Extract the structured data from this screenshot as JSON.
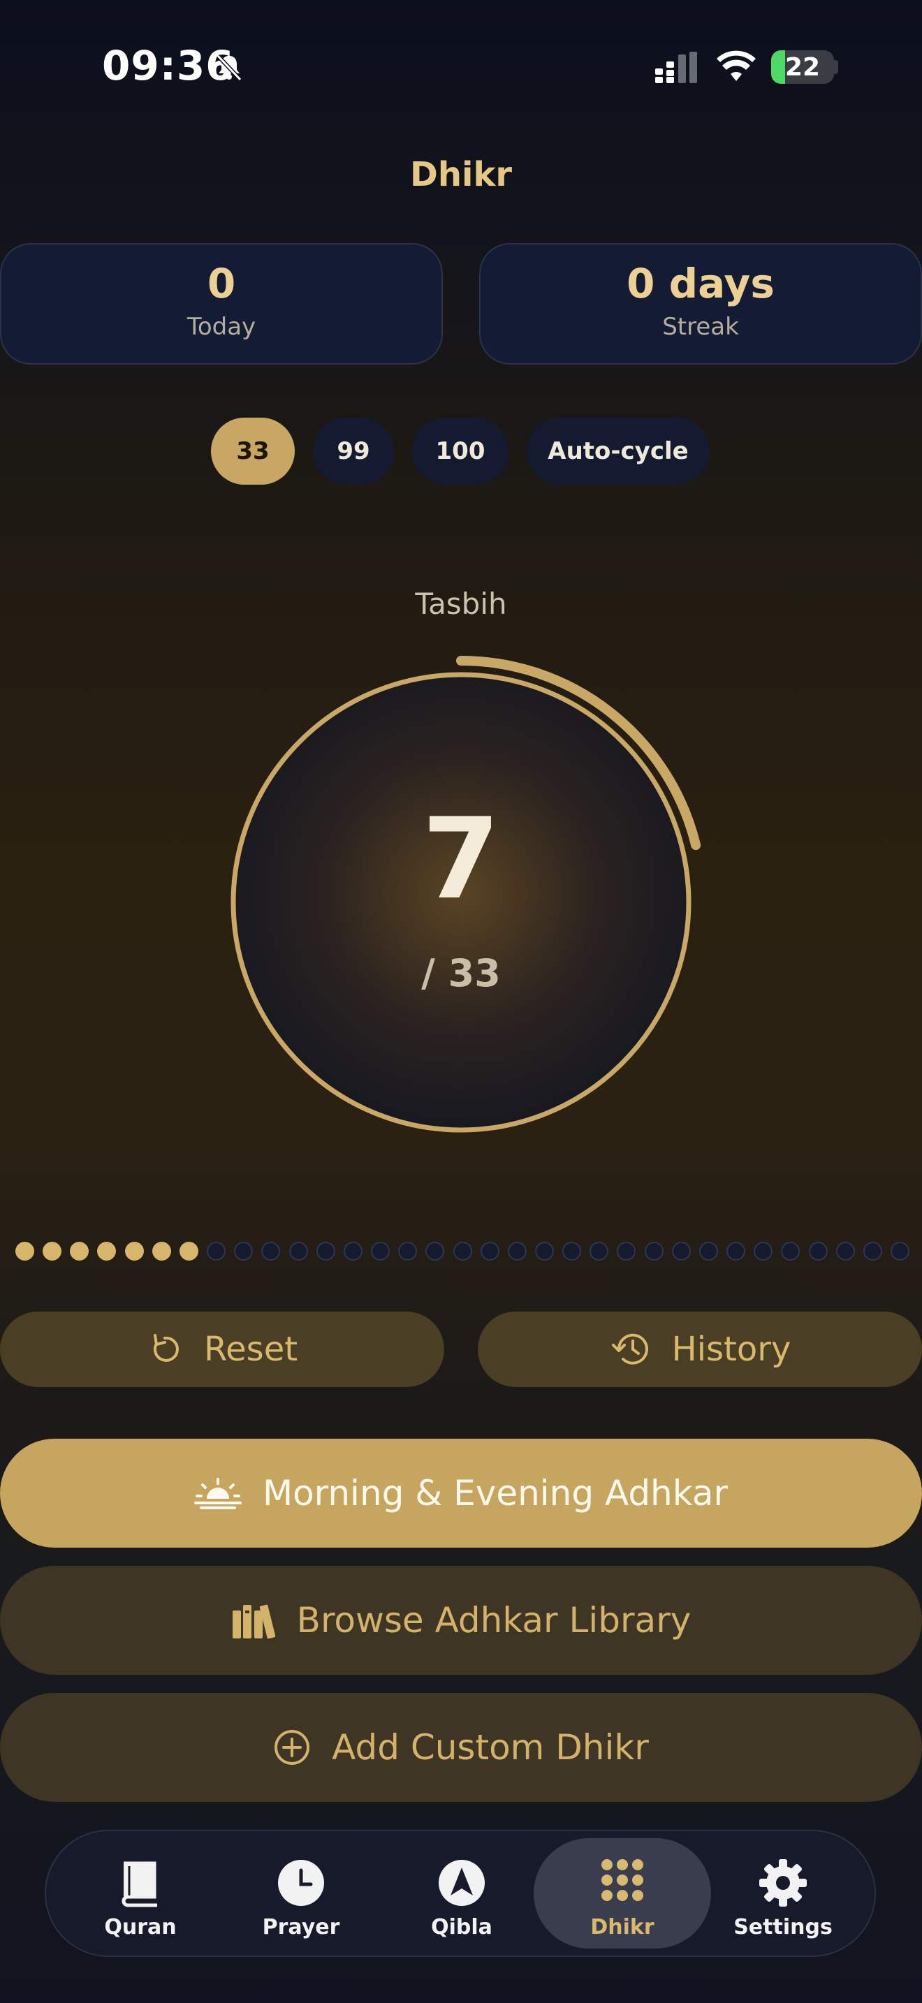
{
  "status_bar": {
    "time": "09:36",
    "battery": "22"
  },
  "header": {
    "title": "Dhikr"
  },
  "stats": {
    "today": {
      "value": "0",
      "label": "Today"
    },
    "streak": {
      "value": "0 days",
      "label": "Streak"
    }
  },
  "targets": [
    "33",
    "99",
    "100",
    "Auto-cycle"
  ],
  "selected_target": "33",
  "counter": {
    "mode": "Tasbih",
    "count": "7",
    "goal": "/ 33",
    "progress_fraction": 0.212
  },
  "beads": {
    "filled": 7,
    "total": 33
  },
  "actions": {
    "reset": "Reset",
    "history": "History",
    "morning_evening": "Morning & Evening Adhkar",
    "browse_library": "Browse Adhkar Library",
    "add_custom": "Add Custom Dhikr"
  },
  "tabs": [
    {
      "label": "Quran",
      "icon": "book-icon"
    },
    {
      "label": "Prayer",
      "icon": "clock-icon"
    },
    {
      "label": "Qibla",
      "icon": "compass-icon"
    },
    {
      "label": "Dhikr",
      "icon": "dots-grid-icon"
    },
    {
      "label": "Settings",
      "icon": "gear-icon"
    }
  ],
  "active_tab": "Dhikr",
  "colors": {
    "gold": "#c6a55f",
    "navy": "#141a30",
    "accent_text": "#e6c783"
  }
}
